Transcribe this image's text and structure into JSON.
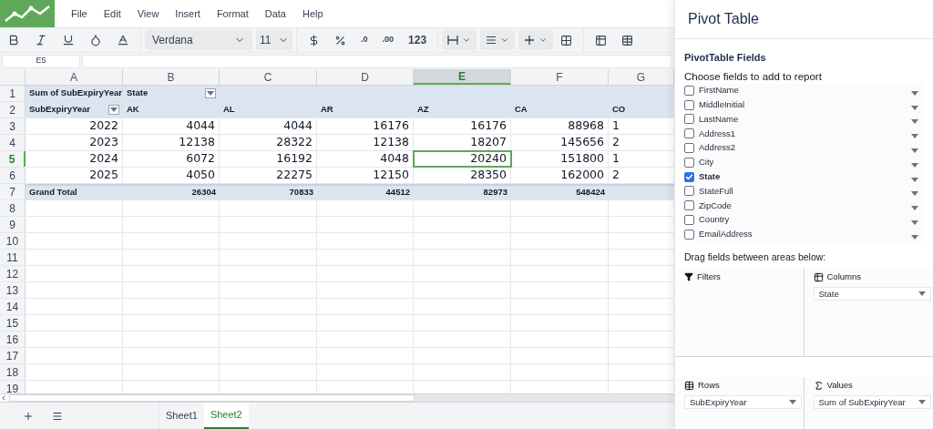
{
  "menu": [
    "File",
    "Edit",
    "View",
    "Insert",
    "Format",
    "Data",
    "Help"
  ],
  "toolbar": {
    "font": "Verdana",
    "size": "11",
    "decrease_decimal": ".0",
    "increase_decimal": ".00",
    "number_format": "123"
  },
  "name_box": "E5",
  "columns": [
    {
      "label": "A",
      "selected": false
    },
    {
      "label": "B",
      "selected": false
    },
    {
      "label": "C",
      "selected": false
    },
    {
      "label": "D",
      "selected": false
    },
    {
      "label": "E",
      "selected": true
    },
    {
      "label": "F",
      "selected": false
    },
    {
      "label": "G",
      "selected": false
    }
  ],
  "rows": [
    {
      "number": "1",
      "selected": false,
      "kind": "header",
      "cells": [
        {
          "text": "Sum of SubExpiryYear",
          "filter": false
        },
        {
          "text": "State",
          "filter": true
        }
      ]
    },
    {
      "number": "2",
      "selected": false,
      "kind": "header",
      "cells": [
        {
          "text": "SubExpiryYear",
          "filter": true
        },
        {
          "text": "AK",
          "filter": false
        },
        {
          "text": "AL",
          "filter": false
        },
        {
          "text": "AR",
          "filter": false
        },
        {
          "text": "AZ",
          "filter": false
        },
        {
          "text": "CA",
          "filter": false
        },
        {
          "text": "CO",
          "filter": false
        }
      ]
    },
    {
      "number": "3",
      "selected": false,
      "kind": "data",
      "cells": [
        {
          "text": "2022",
          "filter": false
        },
        {
          "text": "4044",
          "filter": false
        },
        {
          "text": "4044",
          "filter": false
        },
        {
          "text": "16176",
          "filter": false
        },
        {
          "text": "16176",
          "filter": false
        },
        {
          "text": "88968",
          "filter": false
        },
        {
          "text": "1",
          "filter": false
        }
      ]
    },
    {
      "number": "4",
      "selected": false,
      "kind": "data",
      "cells": [
        {
          "text": "2023",
          "filter": false
        },
        {
          "text": "12138",
          "filter": false
        },
        {
          "text": "28322",
          "filter": false
        },
        {
          "text": "12138",
          "filter": false
        },
        {
          "text": "18207",
          "filter": false
        },
        {
          "text": "145656",
          "filter": false
        },
        {
          "text": "2",
          "filter": false
        }
      ]
    },
    {
      "number": "5",
      "selected": true,
      "kind": "data",
      "cells": [
        {
          "text": "2024",
          "filter": false
        },
        {
          "text": "6072",
          "filter": false
        },
        {
          "text": "16192",
          "filter": false
        },
        {
          "text": "4048",
          "filter": false
        },
        {
          "text": "20240",
          "filter": false
        },
        {
          "text": "151800",
          "filter": false
        },
        {
          "text": "1",
          "filter": false
        }
      ]
    },
    {
      "number": "6",
      "selected": false,
      "kind": "data",
      "cells": [
        {
          "text": "2025",
          "filter": false
        },
        {
          "text": "4050",
          "filter": false
        },
        {
          "text": "22275",
          "filter": false
        },
        {
          "text": "12150",
          "filter": false
        },
        {
          "text": "28350",
          "filter": false
        },
        {
          "text": "162000",
          "filter": false
        },
        {
          "text": "2",
          "filter": false
        }
      ]
    },
    {
      "number": "7",
      "selected": false,
      "kind": "total",
      "cells": [
        {
          "text": "Grand Total",
          "filter": false
        },
        {
          "text": "26304",
          "filter": false
        },
        {
          "text": "70833",
          "filter": false
        },
        {
          "text": "44512",
          "filter": false
        },
        {
          "text": "82973",
          "filter": false
        },
        {
          "text": "548424",
          "filter": false
        }
      ]
    },
    {
      "number": "8",
      "selected": false,
      "kind": "empty",
      "cells": []
    },
    {
      "number": "9",
      "selected": false,
      "kind": "empty",
      "cells": []
    },
    {
      "number": "10",
      "selected": false,
      "kind": "empty",
      "cells": []
    },
    {
      "number": "11",
      "selected": false,
      "kind": "empty",
      "cells": []
    },
    {
      "number": "12",
      "selected": false,
      "kind": "empty",
      "cells": []
    },
    {
      "number": "13",
      "selected": false,
      "kind": "empty",
      "cells": []
    },
    {
      "number": "14",
      "selected": false,
      "kind": "empty",
      "cells": []
    },
    {
      "number": "15",
      "selected": false,
      "kind": "empty",
      "cells": []
    },
    {
      "number": "16",
      "selected": false,
      "kind": "empty",
      "cells": []
    },
    {
      "number": "17",
      "selected": false,
      "kind": "empty",
      "cells": []
    },
    {
      "number": "18",
      "selected": false,
      "kind": "empty",
      "cells": []
    },
    {
      "number": "19",
      "selected": false,
      "kind": "empty",
      "cells": []
    }
  ],
  "sheet_tabs": [
    {
      "label": "Sheet1",
      "selected": false
    },
    {
      "label": "Sheet2",
      "selected": true
    }
  ],
  "pivot_panel": {
    "title": "Pivot Table",
    "section_title": "PivotTable Fields",
    "instruction": "Choose fields to add to report",
    "fields": [
      {
        "label": "FirstName",
        "checked": false
      },
      {
        "label": "MiddleInitial",
        "checked": false
      },
      {
        "label": "LastName",
        "checked": false
      },
      {
        "label": "Address1",
        "checked": false
      },
      {
        "label": "Address2",
        "checked": false
      },
      {
        "label": "City",
        "checked": false
      },
      {
        "label": "State",
        "checked": true
      },
      {
        "label": "StateFull",
        "checked": false
      },
      {
        "label": "ZipCode",
        "checked": false
      },
      {
        "label": "Country",
        "checked": false
      },
      {
        "label": "EmailAddress",
        "checked": false
      }
    ],
    "areas_instruction": "Drag fields between areas below:",
    "areas": [
      {
        "kind": "filters",
        "label": "Filters"
      },
      {
        "kind": "columns",
        "label": "Columns",
        "items": [
          "State"
        ]
      },
      {
        "kind": "rows",
        "label": "Rows",
        "items": [
          "SubExpiryYear"
        ]
      },
      {
        "kind": "values",
        "label": "Values",
        "items": [
          "Sum of SubExpiryYear"
        ]
      }
    ]
  }
}
